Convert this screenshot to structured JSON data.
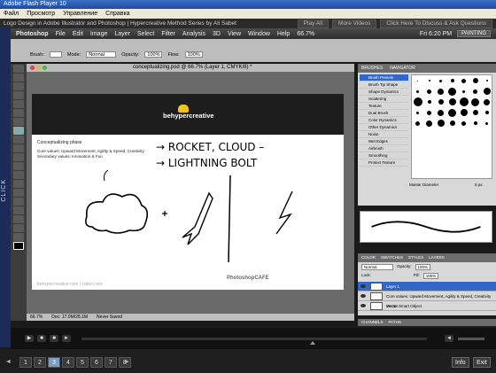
{
  "window": {
    "title": "Adobe Flash Player 10"
  },
  "menu": [
    "Файл",
    "Просмотр",
    "Управление",
    "Справка"
  ],
  "banner": {
    "title": "Logo Design in Adobe Illustrator and Photoshop | Hypercreative Method Series by Ali Sabet",
    "buttons": [
      "Play All",
      "More Videos",
      "Click Here To Discuss & Ask Questions"
    ]
  },
  "left_strip": {
    "label": "CLICK"
  },
  "photoshop": {
    "app": "Photoshop",
    "menu": [
      "File",
      "Edit",
      "Image",
      "Layer",
      "Select",
      "Filter",
      "Analysis",
      "3D",
      "View",
      "Window",
      "Help"
    ],
    "zoom": "66.7%",
    "clock": "Fri 6:20 PM",
    "workspace": "PAINTING"
  },
  "options": {
    "brush_label": "Brush:",
    "mode_label": "Mode:",
    "mode_value": "Normal",
    "opacity_label": "Opacity:",
    "opacity_value": "100%",
    "flow_label": "Flow:",
    "flow_value": "100%"
  },
  "document": {
    "tab": "conceptualizing.psd @ 66.7% (Layer 1, CMYK/8) *",
    "logo_text": "behypercreative",
    "heading": "Conceptualizing phase",
    "lines": [
      "Core values: Upward Movement, Agility & Speed, Creativity",
      "Secondary values: Innovation & Fun"
    ],
    "sketch_line1": "→ ROCKET, CLOUD –",
    "sketch_line2": "→ LIGHTNING BOLT",
    "footer_left": "behypercreative.com | sabet.com",
    "footer_right": "PhotoshopCAFE"
  },
  "status": {
    "zoom": "66.7%",
    "doc": "Doc: 17.0M/28.1M",
    "save": "Never Saved"
  },
  "brush_panel": {
    "tabs": [
      "BRUSHES",
      "NAVIGATOR"
    ],
    "items": [
      "Brush Presets",
      "Brush Tip Shape",
      "Shape Dynamics",
      "Scattering",
      "Texture",
      "Dual Brush",
      "Color Dynamics",
      "Other Dynamics",
      "Noise",
      "Wet Edges",
      "Airbrush",
      "Smoothing",
      "Protect Texture"
    ],
    "master_label": "Master Diameter",
    "master_value": "5 px"
  },
  "layers_panel": {
    "tabs": [
      "COLOR",
      "SWATCHES",
      "STYLES",
      "LAYERS"
    ],
    "mode": "Normal",
    "opacity_label": "Opacity:",
    "opacity_value": "100%",
    "lock_label": "Lock:",
    "fill_label": "Fill:",
    "fill_value": "100%",
    "layers": [
      "Layer 1",
      "Core values: Upward Movement, Agility & Speed, Creativity Secon",
      "Vector Smart Object"
    ]
  },
  "channels_tabs": [
    "CHANNELS",
    "PATHS"
  ],
  "chapters": {
    "prev": "◄",
    "next": "►",
    "items": [
      "1",
      "2",
      "3",
      "4",
      "5",
      "6",
      "7",
      "8"
    ],
    "current": 2,
    "info": "Info",
    "exit": "Exit"
  },
  "colors": {
    "selection": "#3168c8",
    "bulb": "#f2c419"
  }
}
